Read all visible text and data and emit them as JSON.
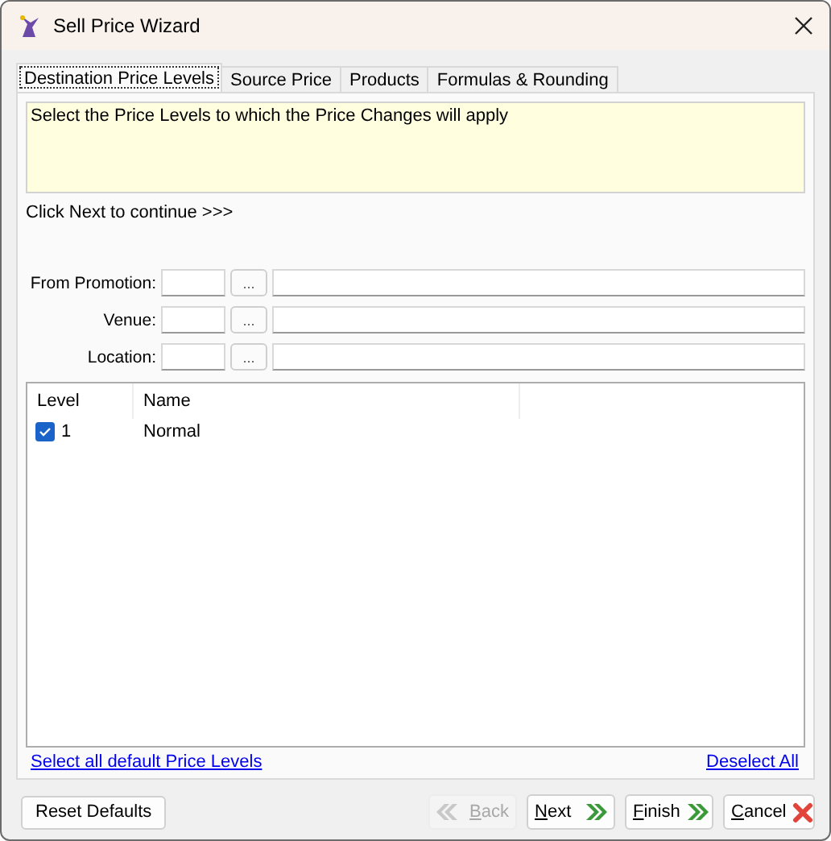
{
  "window": {
    "title": "Sell Price Wizard"
  },
  "tabs": [
    {
      "label": "Destination Price Levels",
      "selected": true
    },
    {
      "label": "Source Price",
      "selected": false
    },
    {
      "label": "Products",
      "selected": false
    },
    {
      "label": "Formulas & Rounding",
      "selected": false
    }
  ],
  "instructions": "Select the Price Levels to which the Price Changes will apply",
  "hint": "Click Next to continue >>>",
  "lookups": [
    {
      "label": "From Promotion:",
      "button": "..."
    },
    {
      "label": "Venue:",
      "button": "..."
    },
    {
      "label": "Location:",
      "button": "..."
    }
  ],
  "table": {
    "columns": [
      "Level",
      "Name"
    ],
    "rows": [
      {
        "checked": true,
        "level": "1",
        "name": "Normal"
      }
    ]
  },
  "links": [
    "Select all default Price Levels",
    "Deselect All"
  ],
  "reset_button": "Reset Defaults",
  "buttons": [
    {
      "label": "Back",
      "kind": "back",
      "disabled": true
    },
    {
      "label": "Next",
      "kind": "next",
      "disabled": false
    },
    {
      "label": "Finish",
      "kind": "next",
      "disabled": false
    },
    {
      "label": "Cancel",
      "kind": "cancel",
      "disabled": false
    }
  ]
}
